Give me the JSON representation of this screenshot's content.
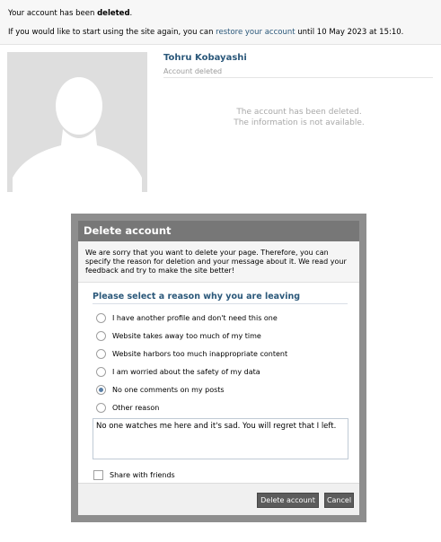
{
  "notice": {
    "line1_prefix": "Your account has been ",
    "line1_bold": "deleted",
    "line1_suffix": ".",
    "line2_prefix": "If you would like to start using the site again, you can ",
    "restore_link": "restore your account",
    "line2_suffix": " until 10 May 2023 at 15:10."
  },
  "profile": {
    "name": "Tohru Kobayashi",
    "status": "Account deleted",
    "deleted_line1": "The account has been deleted.",
    "deleted_line2": "The information is not available."
  },
  "dialog": {
    "title": "Delete account",
    "intro": "We are sorry that you want to delete your page. Therefore, you can specify the reason for deletion and your message about it. We read your feedback and try to make the site better!",
    "reason_title": "Please select a reason why you are leaving",
    "reasons": [
      {
        "label": "I have another profile and don't need this one",
        "selected": false
      },
      {
        "label": "Website takes away too much of my time",
        "selected": false
      },
      {
        "label": "Website harbors too much inappropriate content",
        "selected": false
      },
      {
        "label": "I am worried about the safety of my data",
        "selected": false
      },
      {
        "label": "No one comments on my posts",
        "selected": true
      },
      {
        "label": "Other reason",
        "selected": false
      }
    ],
    "message": "No one watches me here and it's sad. You will regret that I left.",
    "share_label": "Share with friends",
    "share_checked": false,
    "delete_button": "Delete account",
    "cancel_button": "Cancel"
  },
  "colors": {
    "link": "#2b587a",
    "header": "#777777",
    "overlay": "#8e8e8e",
    "button": "#5c5c5c"
  },
  "icons": {
    "avatar": "default-user-silhouette-icon"
  }
}
